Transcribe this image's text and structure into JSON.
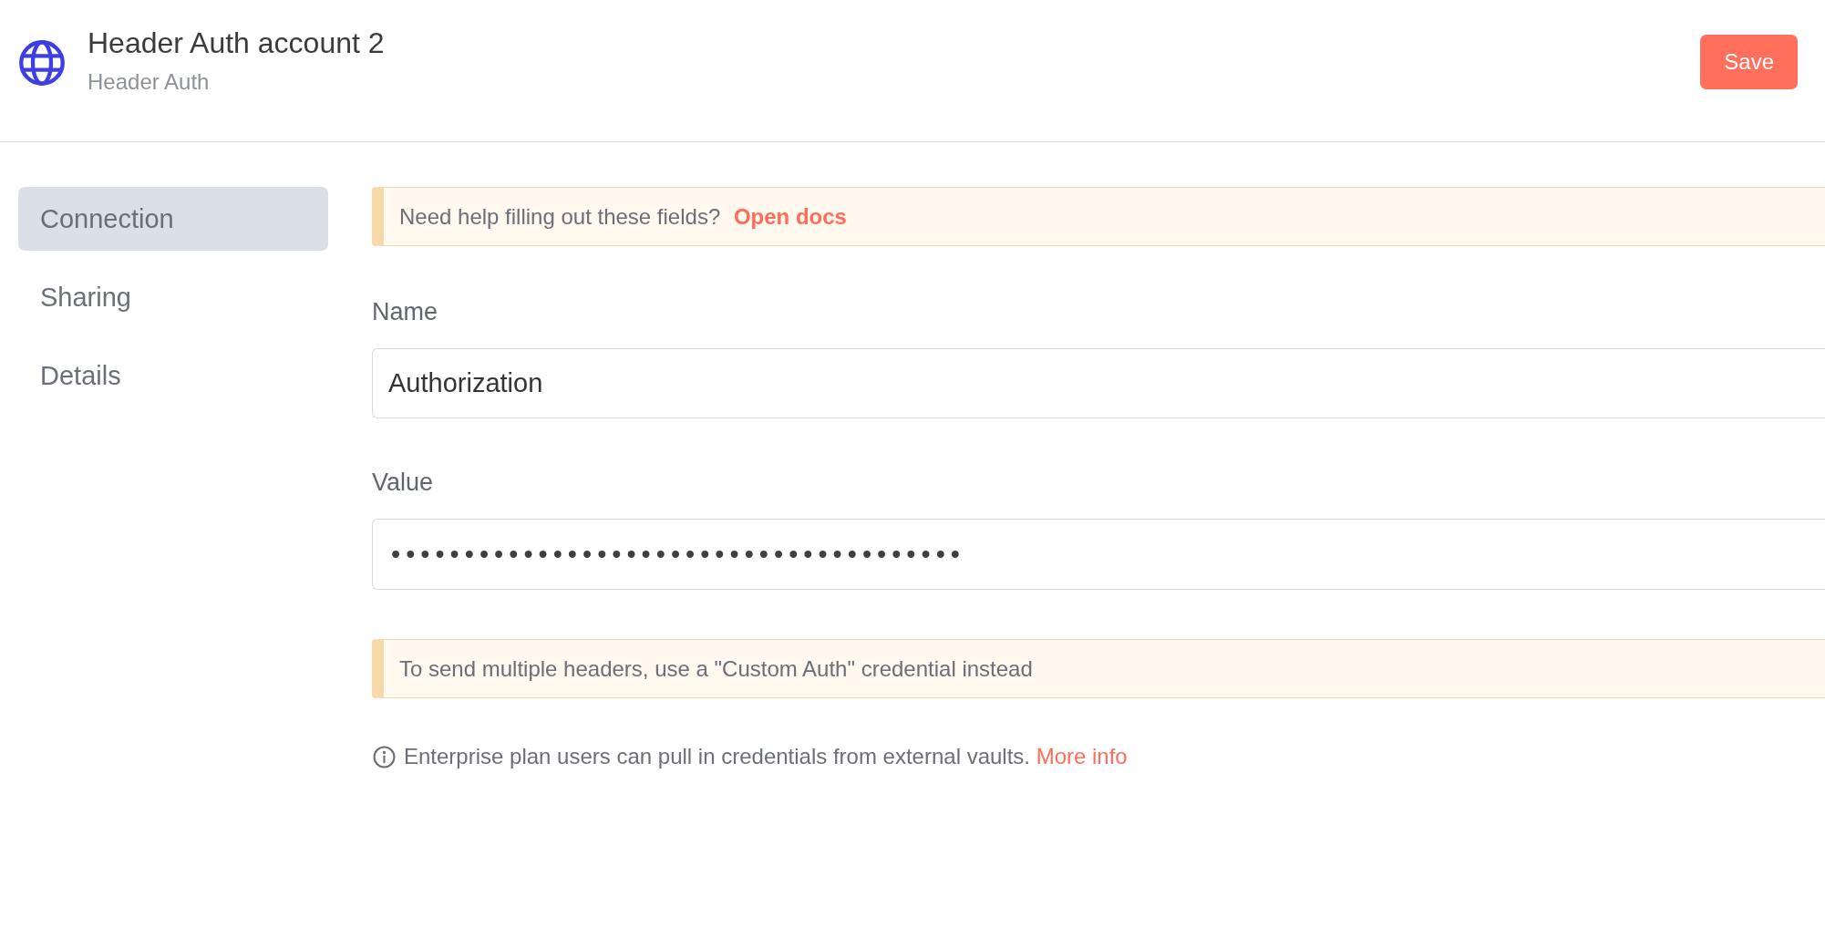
{
  "header": {
    "title": "Header Auth account 2",
    "subtitle": "Header Auth",
    "save_button": "Save"
  },
  "sidebar": {
    "items": [
      {
        "label": "Connection",
        "selected": true
      },
      {
        "label": "Sharing",
        "selected": false
      },
      {
        "label": "Details",
        "selected": false
      }
    ]
  },
  "help_callout": {
    "text": "Need help filling out these fields?",
    "link": "Open docs"
  },
  "fields": [
    {
      "label": "Name",
      "kind": "text",
      "value": "Authorization"
    },
    {
      "label": "Value",
      "kind": "password",
      "value": "•••••••••••••••••••••••••••••••••••••••"
    }
  ],
  "note_callout": {
    "text": "To send multiple headers, use a \"Custom Auth\" credential instead"
  },
  "info": {
    "text": "Enterprise plan users can pull in credentials from external vaults.",
    "link": "More info"
  }
}
